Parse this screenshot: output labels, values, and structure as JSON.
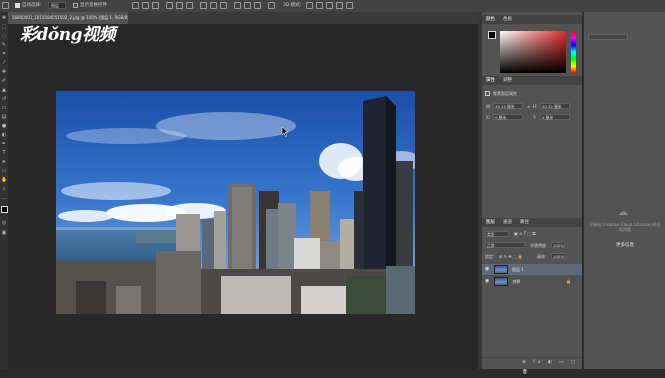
{
  "options_bar": {
    "auto_select_label": "自动选择:",
    "auto_select_value": "图层",
    "show_transform_label": "显示变换控件"
  },
  "document": {
    "tab_title": "56850001_1015584551502_2.jpg @ 100% (图层 1, RGB/8)"
  },
  "watermark": "彩dǒng视频",
  "color_panel": {
    "tabs": [
      "颜色",
      "色板"
    ]
  },
  "properties_panel": {
    "tabs": [
      "属性",
      "调整"
    ],
    "section_label": "像素图层属性",
    "w_label": "W:",
    "w_value": "36.12 厘米",
    "h_label": "H:",
    "h_value": "20.32 厘米",
    "x_label": "X:",
    "x_value": "0 厘米",
    "y_label": "Y:",
    "y_value": "0 厘米"
  },
  "layers_panel": {
    "tabs": [
      "图层",
      "通道",
      "路径"
    ],
    "filter_value": "类型",
    "blend_mode": "正常",
    "opacity_label": "不透明度:",
    "opacity_value": "100%",
    "lock_label": "锁定:",
    "fill_label": "填充:",
    "fill_value": "100%",
    "layers": [
      {
        "name": "图层 1"
      },
      {
        "name": "背景"
      }
    ]
  },
  "libraries_panel": {
    "message": "初始化 Creative Cloud Libraries 时出现问题",
    "link": "更多信息"
  },
  "colors": {
    "accent_blue": "#2f6fd6",
    "panel_gray": "#535353"
  }
}
